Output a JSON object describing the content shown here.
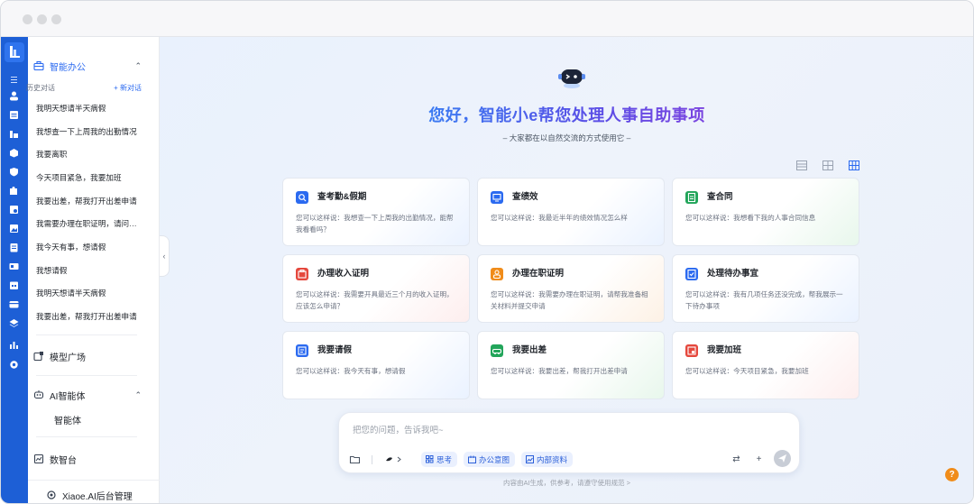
{
  "sidebar": {
    "section_office": "智能办公",
    "history_label": "历史对话",
    "new_chat": "+ 新对话",
    "history": [
      "我明天想请半天病假",
      "我想查一下上周我的出勤情况",
      "我要离职",
      "今天项目紧急，我要加班",
      "我要出差，帮我打开出差申请",
      "我需要办理在职证明，请问需要准备什么",
      "我今天有事，想请假",
      "我想请假",
      "我明天想请半天病假",
      "我要出差，帮我打开出差申请"
    ],
    "model_square": "模型广场",
    "ai_agent": "AI智能体",
    "agent_sub": "智能体",
    "data_platform": "数智台",
    "admin": "Xiaoe.AI后台管理"
  },
  "main": {
    "headline": "您好，智能小e帮您处理人事自助事项",
    "subline": "– 大家都在以自然交流的方式使用它 –",
    "cards": [
      {
        "title": "查考勤&假期",
        "desc": "您可以这样说：我想查一下上周我的出勤情况，能帮我看看吗？",
        "color": "#2b6af0"
      },
      {
        "title": "查绩效",
        "desc": "您可以这样说：我最近半年的绩效情况怎么样",
        "color": "#2b6af0"
      },
      {
        "title": "查合同",
        "desc": "您可以这样说：我想看下我的人事合同信息",
        "color": "#22a55a"
      },
      {
        "title": "办理收入证明",
        "desc": "您可以这样说：我需要开具最近三个月的收入证明，应该怎么申请？",
        "color": "#e5483d"
      },
      {
        "title": "办理在职证明",
        "desc": "您可以这样说：我需要办理在职证明，请帮我准备相关材料并提交申请",
        "color": "#f08c1a"
      },
      {
        "title": "处理待办事宜",
        "desc": "您可以这样说：我有几项任务还没完成，帮我展示一下待办事项",
        "color": "#2b6af0"
      },
      {
        "title": "我要请假",
        "desc": "您可以这样说：我今天有事，想请假",
        "color": "#2b6af0"
      },
      {
        "title": "我要出差",
        "desc": "您可以这样说：我要出差，帮我打开出差申请",
        "color": "#22a55a"
      },
      {
        "title": "我要加班",
        "desc": "您可以这样说：今天项目紧急，我要加班",
        "color": "#e5483d"
      }
    ],
    "input_placeholder": "把您的问题，告诉我吧~",
    "chip_think": "思考",
    "chip_office": "办公意图",
    "chip_internal": "内部资料",
    "disclaimer": "内容由AI生成，供参考，请遵守使用规范 >",
    "help": "?"
  },
  "colors": {
    "brand": "#1d5fd6",
    "accent": "#2b6af0",
    "help": "#f08c1a"
  }
}
